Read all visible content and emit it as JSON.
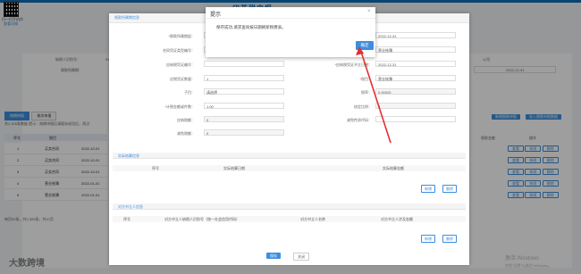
{
  "header": {
    "qr_caption": "扫一扫手机作",
    "qr_link": "查看详情",
    "page_title": "印花税申报"
  },
  "background": {
    "row1_label": "纳税人识别号：",
    "row1_value": "91",
    "row2_label": "税款所属期：",
    "row2_value": "2022-12-31",
    "right_value": "公司",
    "tabs": [
      "按期申报",
      "按次申报"
    ],
    "info_line": "共2,305条数据   提示：按期申报后请报存成功后，再点",
    "table_headers": [
      "序号",
      "税目"
    ],
    "rows": [
      {
        "no": "1",
        "item": "买卖合同",
        "date": "2022-10-01"
      },
      {
        "no": "2",
        "item": "买卖合同",
        "date": "2022-10-01"
      },
      {
        "no": "3",
        "item": "买卖合同",
        "date": "2022-10-01"
      },
      {
        "no": "4",
        "item": "营业账簿",
        "date": "2022-01-01"
      },
      {
        "no": "5",
        "item": "营业账簿",
        "date": "2022-01-01"
      }
    ],
    "row_actions": [
      "查看",
      "修改",
      "删除"
    ],
    "op_header": "操作",
    "amount_header": "税款金额",
    "right_tools": [
      "新增税款申报",
      "导入税款申报数据"
    ],
    "pagination": "每页50条，共2,305条，共47页",
    "footer_logo": "大数跨境",
    "watermark_line1": "激活 Windows",
    "watermark_line2": "转到\"设置\"以激活 Windows。"
  },
  "modal": {
    "section1_title": "税款所属期信息",
    "fields_left": [
      {
        "label": "税款所属期起：",
        "value": "",
        "required": true
      },
      {
        "label": "合同凭证类型编号：",
        "value": ""
      },
      {
        "label": "应纳税凭证编号：",
        "value": ""
      },
      {
        "label": "应税凭证数量：",
        "value": "1"
      },
      {
        "label": "子目：",
        "value": "请选择"
      },
      {
        "label": "计税金额或件数：",
        "value": "1.00",
        "required": true
      },
      {
        "label": "应纳税额：",
        "value": "0"
      },
      {
        "label": "减免税额：",
        "value": "0"
      }
    ],
    "fields_right": [
      {
        "label": "",
        "value": "2022-12-31"
      },
      {
        "label": "",
        "value": "营业账簿"
      },
      {
        "label": "应纳税凭证书立日期：",
        "value": "2022-12-31",
        "required": true
      },
      {
        "label": "税目：",
        "value": "营业账簿",
        "required": true
      },
      {
        "label": "税率：",
        "value": "0.00025"
      },
      {
        "label": "核定比例：",
        "value": "0"
      },
      {
        "label": "减免性质代码：",
        "value": ""
      }
    ],
    "section2_title": "实际结算信息",
    "section2_headers": [
      "序号",
      "实际结算日期",
      "实际结算金额"
    ],
    "section3_title": "对方书立人信息",
    "section3_headers": [
      "序号",
      "对方书立人纳税人识别号（统一社会信用代码）",
      "对方书立人名称",
      "对方书立人涉及金额"
    ],
    "add_label": "新增",
    "delete_label": "删除",
    "save_label": "保存",
    "close_label": "关闭"
  },
  "dialog": {
    "title": "提示",
    "message": "保存成功,请求查询按日期刷新税费表。",
    "ok_label": "确定",
    "close_icon": "×"
  }
}
